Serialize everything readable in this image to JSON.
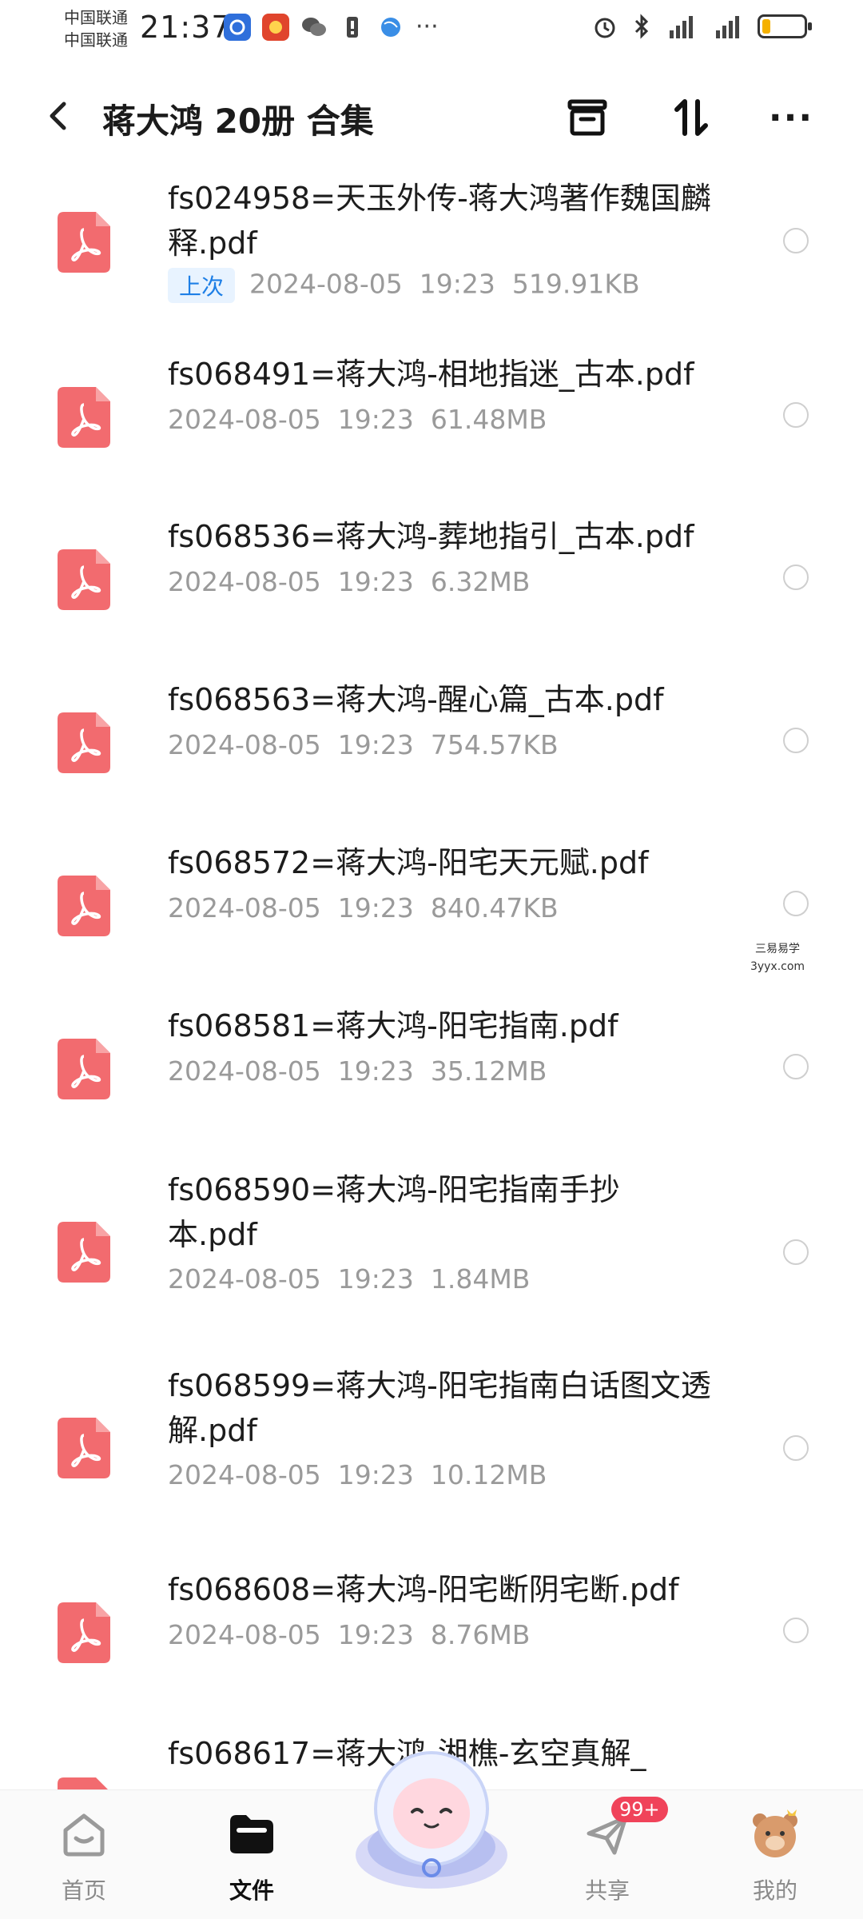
{
  "status_bar": {
    "carrier_1": "中国联通",
    "carrier_2": "中国联通",
    "time": "21:37",
    "more_dots": "···",
    "battery_level": 0.2
  },
  "header": {
    "title": "蒋大鸿 20册 合集",
    "more_label": "···"
  },
  "files": [
    {
      "name": "fs024958=天玉外传-蒋大鸿著作魏国麟释.pdf",
      "badge": "上次",
      "date": "2024-08-05",
      "time": "19:23",
      "size": "519.91KB"
    },
    {
      "name": "fs068491=蒋大鸿-相地指迷_古本.pdf",
      "date": "2024-08-05",
      "time": "19:23",
      "size": "61.48MB"
    },
    {
      "name": "fs068536=蒋大鸿-葬地指引_古本.pdf",
      "date": "2024-08-05",
      "time": "19:23",
      "size": "6.32MB"
    },
    {
      "name": "fs068563=蒋大鸿-醒心篇_古本.pdf",
      "date": "2024-08-05",
      "time": "19:23",
      "size": "754.57KB"
    },
    {
      "name": "fs068572=蒋大鸿-阳宅天元赋.pdf",
      "date": "2024-08-05",
      "time": "19:23",
      "size": "840.47KB"
    },
    {
      "name": "fs068581=蒋大鸿-阳宅指南.pdf",
      "date": "2024-08-05",
      "time": "19:23",
      "size": "35.12MB"
    },
    {
      "name": "fs068590=蒋大鸿-阳宅指南手抄本.pdf",
      "date": "2024-08-05",
      "time": "19:23",
      "size": "1.84MB"
    },
    {
      "name": "fs068599=蒋大鸿-阳宅指南白话图文透解.pdf",
      "date": "2024-08-05",
      "time": "19:23",
      "size": "10.12MB"
    },
    {
      "name": "fs068608=蒋大鸿-阳宅断阴宅断.pdf",
      "date": "2024-08-05",
      "time": "19:23",
      "size": "8.76MB"
    },
    {
      "name": "fs068617=蒋大鸿-湘樵-玄空真解_"
    }
  ],
  "watermark": {
    "line1": "三易易学",
    "line2": "3yyx.com"
  },
  "bottom_nav": {
    "home": "首页",
    "files": "文件",
    "share": "共享",
    "share_badge": "99+",
    "mine": "我的"
  },
  "colors": {
    "pdf_icon": "#f26b6f",
    "accent_blue": "#1e7fe6",
    "badge_red": "#f0435a"
  }
}
